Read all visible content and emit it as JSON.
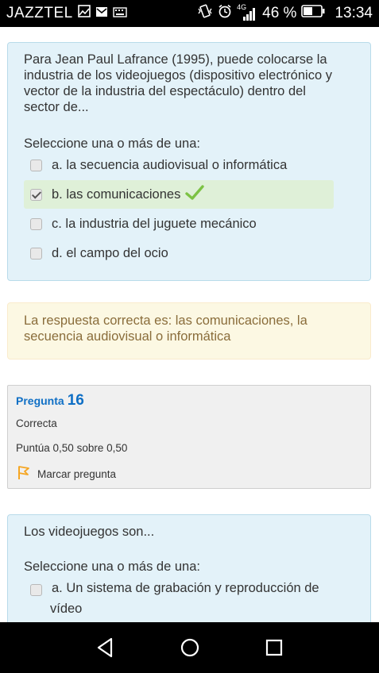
{
  "status_bar": {
    "carrier": "JAZZTEL",
    "network": "4G",
    "battery_percent": "46 %",
    "time": "13:34",
    "icons": [
      "image-icon",
      "mail-icon",
      "keyboard-icon",
      "vibrate-icon",
      "alarm-icon",
      "signal-icon",
      "battery-icon"
    ]
  },
  "question_15": {
    "text": "Para Jean Paul Lafrance (1995), puede colocarse la industria de los videojuegos (dispositivo electrónico y vector de la industria del espectáculo) dentro del sector de...",
    "prompt": "Seleccione una o más de una:",
    "options": [
      {
        "label": "a. la secuencia audiovisual o informática",
        "checked": false,
        "correct": false
      },
      {
        "label": "b. las comunicaciones",
        "checked": true,
        "correct": true
      },
      {
        "label": "c. la industria del juguete mecánico",
        "checked": false,
        "correct": false
      },
      {
        "label": "d. el campo del ocio",
        "checked": false,
        "correct": false
      }
    ],
    "feedback": "La respuesta correcta es: las comunicaciones, la secuencia audiovisual o informática"
  },
  "question_16": {
    "label": "Pregunta",
    "number": "16",
    "state": "Correcta",
    "grade": "Puntúa 0,50 sobre 0,50",
    "flag_label": "Marcar pregunta",
    "text": "Los videojuegos son...",
    "prompt": "Seleccione una o más de una:",
    "options": [
      {
        "label_line1": "a. Un sistema de grabación y reproducción de",
        "label_line2": "vídeo",
        "checked": false
      }
    ]
  },
  "colors": {
    "question_bg": "#e3f2f9",
    "correct_bg": "#dff0d8",
    "feedback_bg": "#fcf8e3",
    "feedback_text": "#8a6d3b",
    "info_bg": "#f0f0f0",
    "link_blue": "#0f6fc5",
    "tick_green": "#7cc243",
    "flag_orange": "#f5a623"
  }
}
